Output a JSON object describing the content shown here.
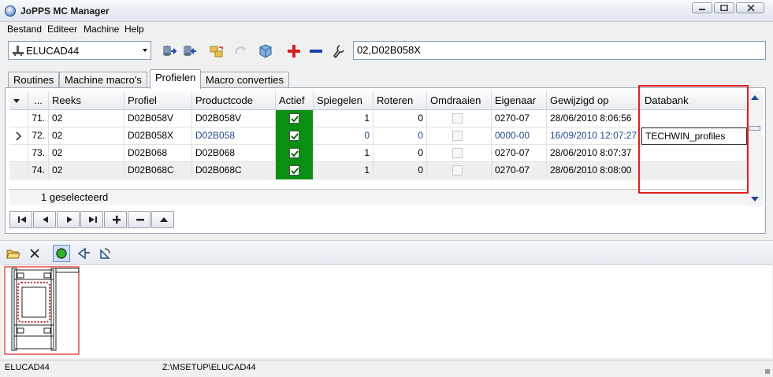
{
  "window": {
    "title": "JoPPS MC Manager"
  },
  "menu": [
    {
      "label": "Bestand"
    },
    {
      "label": "Editeer"
    },
    {
      "label": "Machine"
    },
    {
      "label": "Help"
    }
  ],
  "toolbar": {
    "machine_value": "ELUCAD44",
    "search_value": "02,D02B058X",
    "icons": [
      "machine-icon",
      "export-icon",
      "import-icon",
      "folder-transfer-icon",
      "refresh-icon",
      "cube-icon",
      "add-icon",
      "remove-icon",
      "wrench-icon"
    ]
  },
  "tabs": [
    {
      "label": "Routines"
    },
    {
      "label": "Machine macro's"
    },
    {
      "label": "Profielen"
    },
    {
      "label": "Macro converties"
    }
  ],
  "grid": {
    "columns": [
      {
        "label": "..."
      },
      {
        "label": "Reeks"
      },
      {
        "label": "Profiel"
      },
      {
        "label": "Productcode"
      },
      {
        "label": "Actief"
      },
      {
        "label": "Spiegelen"
      },
      {
        "label": "Roteren"
      },
      {
        "label": "Omdraaien"
      },
      {
        "label": "Eigenaar"
      },
      {
        "label": "Gewijzigd op"
      },
      {
        "label": "Databank"
      }
    ],
    "rows": [
      {
        "num": "71.",
        "reeks": "02",
        "profiel": "D02B058V",
        "productcode": "D02B058V",
        "actief": true,
        "spiegelen": "1",
        "roteren": "0",
        "omdraaien": false,
        "eigenaar": "0270-07",
        "gewijzigd": "28/06/2010 8:06:56",
        "databank": ""
      },
      {
        "num": "72.",
        "reeks": "02",
        "profiel": "D02B058X",
        "productcode": "D02B058",
        "actief": true,
        "spiegelen": "0",
        "roteren": "0",
        "omdraaien": false,
        "eigenaar": "0000-00",
        "gewijzigd": "16/09/2010 12:07:27",
        "databank": "TECHWIN_profiles"
      },
      {
        "num": "73.",
        "reeks": "02",
        "profiel": "D02B068",
        "productcode": "D02B068",
        "actief": true,
        "spiegelen": "1",
        "roteren": "0",
        "omdraaien": false,
        "eigenaar": "0270-07",
        "gewijzigd": "28/06/2010 8:07:37",
        "databank": ""
      },
      {
        "num": "74.",
        "reeks": "02",
        "profiel": "D02B068C",
        "productcode": "D02B068C",
        "actief": true,
        "spiegelen": "1",
        "roteren": "0",
        "omdraaien": false,
        "eigenaar": "0270-07",
        "gewijzigd": "28/06/2010 8:08:00",
        "databank": ""
      }
    ],
    "selection_text": "1 geselecteerd"
  },
  "navigator": [
    "first-record-icon",
    "prior-record-icon",
    "next-record-icon",
    "last-record-icon",
    "insert-icon",
    "delete-icon",
    "post-icon"
  ],
  "viewer_toolbar": [
    "open-folder-icon",
    "close-icon",
    "green-circle-icon",
    "mirror-icon",
    "rotate-icon"
  ],
  "status": {
    "left": "ELUCAD44",
    "path": "Z:\\MSETUP\\ELUCAD44"
  }
}
